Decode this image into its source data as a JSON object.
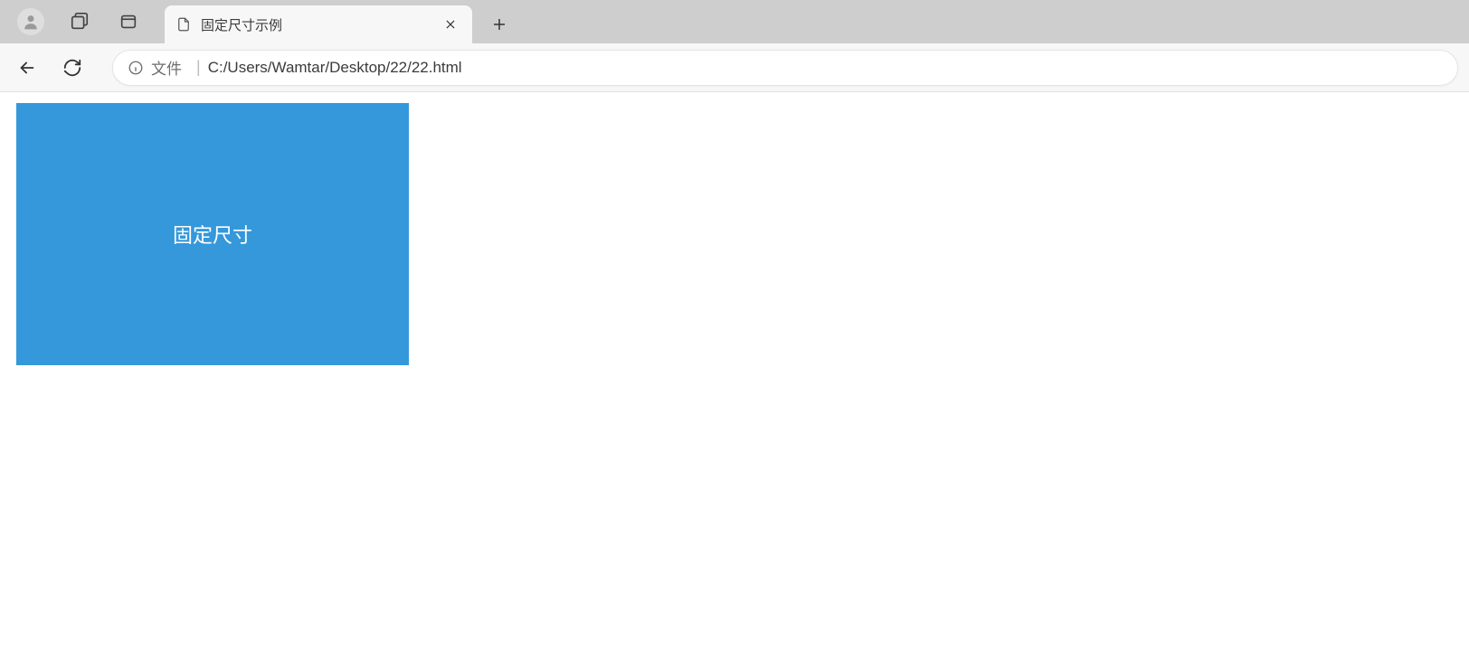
{
  "browser": {
    "tab": {
      "title": "固定尺寸示例"
    },
    "address": {
      "file_label": "文件",
      "url": "C:/Users/Wamtar/Desktop/22/22.html"
    }
  },
  "page": {
    "box_text": "固定尺寸",
    "box_color": "#3498db"
  }
}
